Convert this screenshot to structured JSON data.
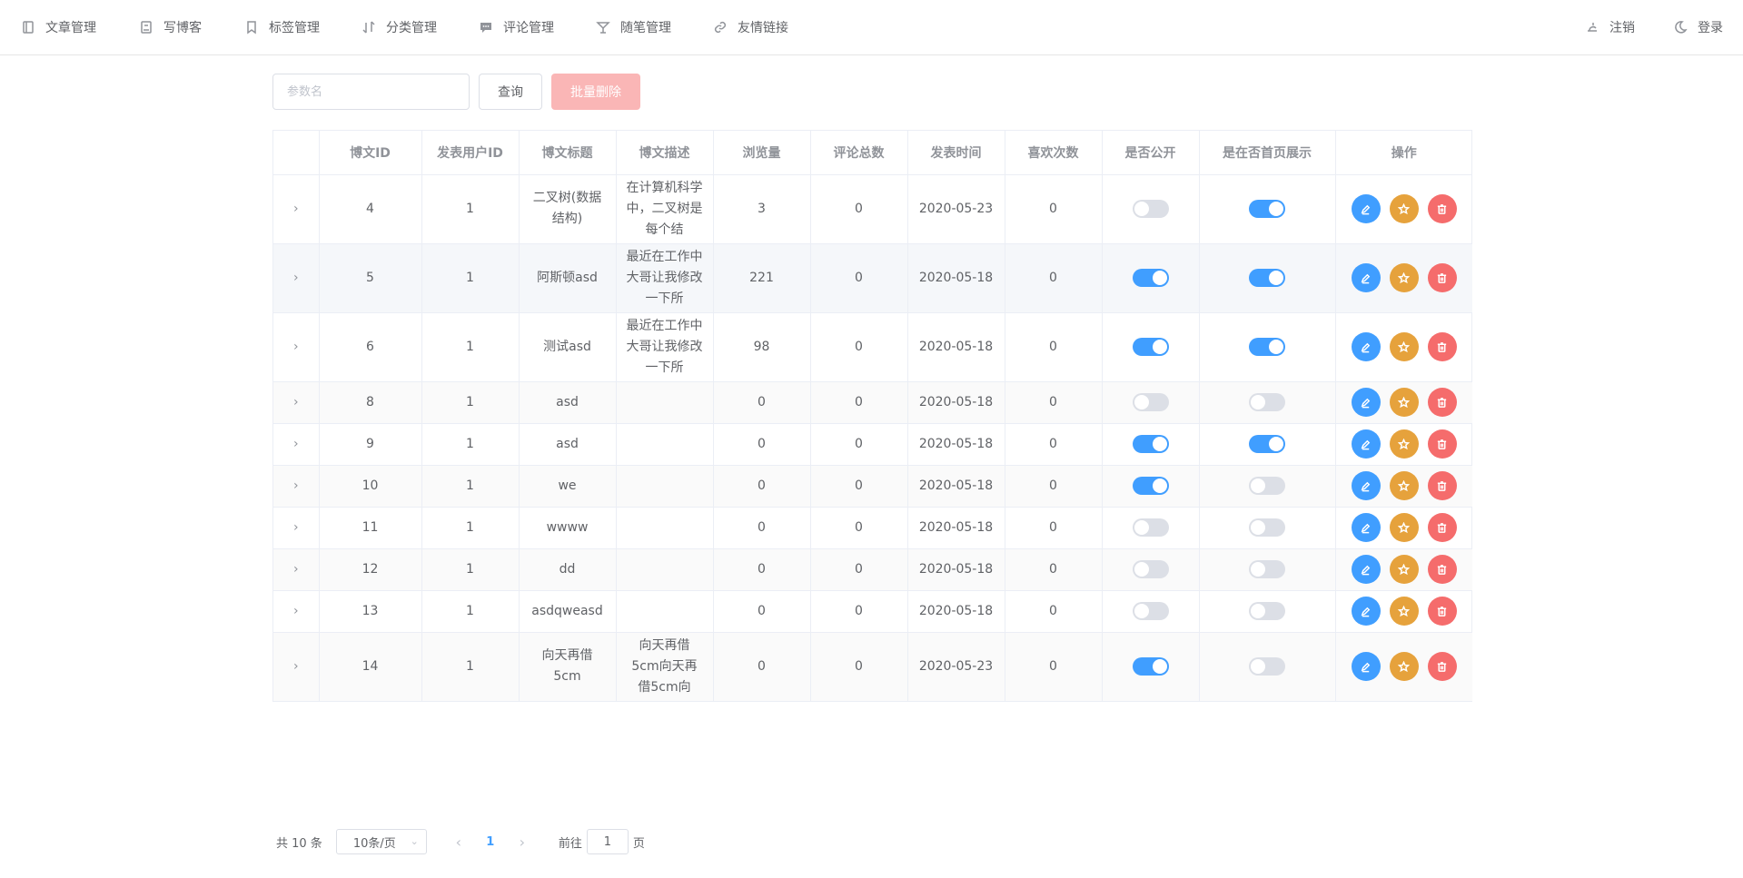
{
  "nav": {
    "left": [
      {
        "label": "文章管理",
        "icon": "notebook-icon"
      },
      {
        "label": "写博客",
        "icon": "document-icon"
      },
      {
        "label": "标签管理",
        "icon": "bookmark-icon"
      },
      {
        "label": "分类管理",
        "icon": "sort-icon"
      },
      {
        "label": "评论管理",
        "icon": "chat-icon"
      },
      {
        "label": "随笔管理",
        "icon": "cocktail-icon"
      },
      {
        "label": "友情链接",
        "icon": "link-icon"
      }
    ],
    "right": [
      {
        "label": "注销",
        "icon": "logout-icon"
      },
      {
        "label": "登录",
        "icon": "moon-icon"
      }
    ]
  },
  "toolbar": {
    "search_placeholder": "参数名",
    "query_label": "查询",
    "batch_delete_label": "批量删除"
  },
  "table": {
    "headers": [
      "",
      "博文ID",
      "发表用户ID",
      "博文标题",
      "博文描述",
      "浏览量",
      "评论总数",
      "发表时间",
      "喜欢次数",
      "是否公开",
      "是在否首页展示",
      "操作"
    ],
    "rows": [
      {
        "id": "4",
        "uid": "1",
        "title": "二叉树(数据结构)",
        "desc": "在计算机科学中，二叉树是每个结",
        "views": "3",
        "comments": "0",
        "date": "2020-05-23",
        "likes": "0",
        "public": false,
        "home": true
      },
      {
        "id": "5",
        "uid": "1",
        "title": "阿斯顿asd",
        "desc": "最近在工作中大哥让我修改一下所",
        "views": "221",
        "comments": "0",
        "date": "2020-05-18",
        "likes": "0",
        "public": true,
        "home": true
      },
      {
        "id": "6",
        "uid": "1",
        "title": "测试asd",
        "desc": "最近在工作中大哥让我修改一下所",
        "views": "98",
        "comments": "0",
        "date": "2020-05-18",
        "likes": "0",
        "public": true,
        "home": true
      },
      {
        "id": "8",
        "uid": "1",
        "title": "asd",
        "desc": "",
        "views": "0",
        "comments": "0",
        "date": "2020-05-18",
        "likes": "0",
        "public": false,
        "home": false
      },
      {
        "id": "9",
        "uid": "1",
        "title": "asd",
        "desc": "",
        "views": "0",
        "comments": "0",
        "date": "2020-05-18",
        "likes": "0",
        "public": true,
        "home": true
      },
      {
        "id": "10",
        "uid": "1",
        "title": "we",
        "desc": "",
        "views": "0",
        "comments": "0",
        "date": "2020-05-18",
        "likes": "0",
        "public": true,
        "home": false
      },
      {
        "id": "11",
        "uid": "1",
        "title": "wwww",
        "desc": "",
        "views": "0",
        "comments": "0",
        "date": "2020-05-18",
        "likes": "0",
        "public": false,
        "home": false
      },
      {
        "id": "12",
        "uid": "1",
        "title": "dd",
        "desc": "",
        "views": "0",
        "comments": "0",
        "date": "2020-05-18",
        "likes": "0",
        "public": false,
        "home": false
      },
      {
        "id": "13",
        "uid": "1",
        "title": "asdqweasd",
        "desc": "",
        "views": "0",
        "comments": "0",
        "date": "2020-05-18",
        "likes": "0",
        "public": false,
        "home": false
      },
      {
        "id": "14",
        "uid": "1",
        "title": "向天再借5cm",
        "desc": "向天再借5cm向天再借5cm向",
        "views": "0",
        "comments": "0",
        "date": "2020-05-23",
        "likes": "0",
        "public": true,
        "home": false
      }
    ]
  },
  "pagination": {
    "total_label": "共 10 条",
    "page_size": "10条/页",
    "current_page": "1",
    "goto_prefix": "前往",
    "goto_value": "1",
    "goto_suffix": "页"
  },
  "colors": {
    "primary": "#409eff",
    "warning": "#e6a23c",
    "danger": "#f56c6c",
    "danger_light": "#fab6b6"
  }
}
